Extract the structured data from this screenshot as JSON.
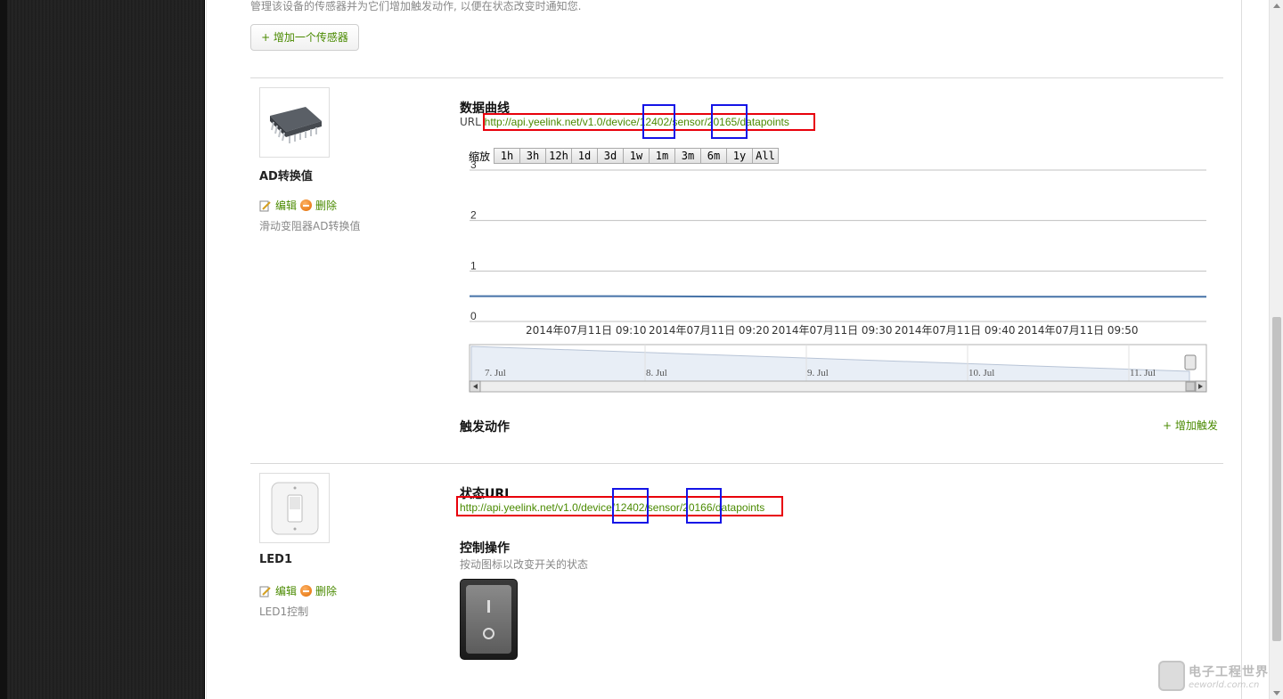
{
  "intro_text": "管理该设备的传感器并为它们增加触发动作, 以便在状态改变时通知您.",
  "add_sensor_label": "+ 增加一个传感器",
  "sensor1": {
    "name": "AD转换值",
    "edit_label": "编辑",
    "delete_label": "删除",
    "description": "滑动变阻器AD转换值",
    "curve_title": "数据曲线",
    "url_prefix": "URL",
    "url": "http://api.yeelink.net/v1.0/device/12402/sensor/20165/datapoints",
    "trigger_title": "触发动作",
    "add_trigger_label": "+ 增加触发"
  },
  "chart_zoom": {
    "label": "缩放",
    "buttons": [
      "1h",
      "3h",
      "12h",
      "1d",
      "3d",
      "1w",
      "1m",
      "3m",
      "6m",
      "1y",
      "All"
    ]
  },
  "chart_data": {
    "type": "line",
    "title": "",
    "xlabel": "",
    "ylabel": "",
    "ylim": [
      0,
      3
    ],
    "y_ticks": [
      "0",
      "1",
      "2",
      "3"
    ],
    "x_ticks": [
      "2014年07月11日 09:10",
      "2014年07月11日 09:20",
      "2014年07月11日 09:30",
      "2014年07月11日 09:40",
      "2014年07月11日 09:50"
    ],
    "series": [
      {
        "values": [
          0.5,
          0.5,
          0.49,
          0.49,
          0.49,
          0.49
        ],
        "x": [
          "09:03",
          "09:10",
          "09:20",
          "09:30",
          "09:40",
          "09:50"
        ]
      }
    ],
    "navigator_ticks": [
      "7. Jul",
      "8. Jul",
      "9. Jul",
      "10. Jul",
      "11. Jul"
    ],
    "line_color": "#4572a7"
  },
  "sensor2": {
    "name": "LED1",
    "edit_label": "编辑",
    "delete_label": "删除",
    "description": "LED1控制",
    "status_url_title": "状态URL",
    "url": "http://api.yeelink.net/v1.0/device/12402/sensor/20166/datapoints",
    "control_title": "控制操作",
    "control_hint": "按动图标以改变开关的状态"
  },
  "watermark": {
    "cn": "电子工程世界",
    "en": "eeworld.com.cn"
  },
  "colors": {
    "link": "#4a8a00",
    "highlight_red": "#e8000b",
    "highlight_blue": "#1414e6"
  }
}
